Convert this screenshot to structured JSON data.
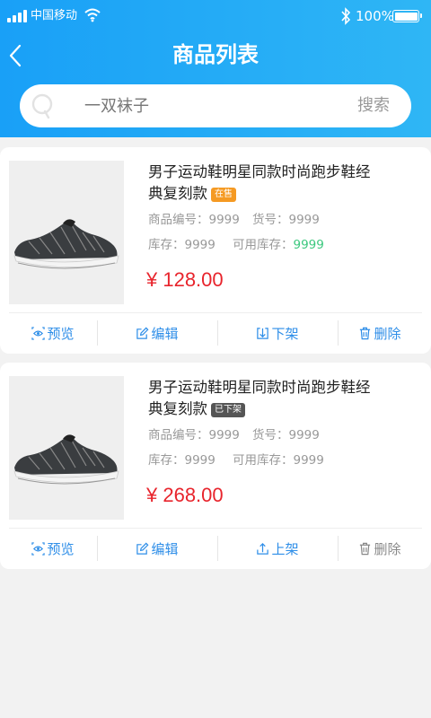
{
  "status_bar": {
    "carrier": "中国移动",
    "battery": "100%"
  },
  "header": {
    "title": "商品列表"
  },
  "search": {
    "placeholder": "一双袜子",
    "button": "搜索"
  },
  "products": [
    {
      "name": "男子运动鞋明星同款时尚跑步鞋经典复刻款",
      "status": "在售",
      "code_label": "商品编号：",
      "code": "9999",
      "sku_label": "货号：",
      "sku": "9999",
      "stock_label": "库存：",
      "stock": "9999",
      "avail_label": "可用库存：",
      "avail": "9999",
      "price": "¥ 128.00",
      "actions": {
        "preview": "预览",
        "edit": "编辑",
        "shelf": "下架",
        "delete": "删除"
      }
    },
    {
      "name": "男子运动鞋明星同款时尚跑步鞋经典复刻款",
      "status": "已下架",
      "code_label": "商品编号：",
      "code": "9999",
      "sku_label": "货号：",
      "sku": "9999",
      "stock_label": "库存：",
      "stock": "9999",
      "avail_label": "可用库存：",
      "avail": "9999",
      "price": "¥ 268.00",
      "actions": {
        "preview": "预览",
        "edit": "编辑",
        "shelf": "上架",
        "delete": "删除"
      }
    }
  ],
  "colors": {
    "accent": "#1e9ff2",
    "price": "#e8242c",
    "badge_on": "#f59a23",
    "badge_off": "#555555",
    "avail_green": "#3cc87e"
  },
  "icons": {
    "back": "chevron-left-icon",
    "search": "search-icon",
    "preview": "eye-icon",
    "edit": "edit-icon",
    "unshelf": "arrow-down-icon",
    "shelf": "arrow-up-icon",
    "delete": "trash-icon"
  }
}
